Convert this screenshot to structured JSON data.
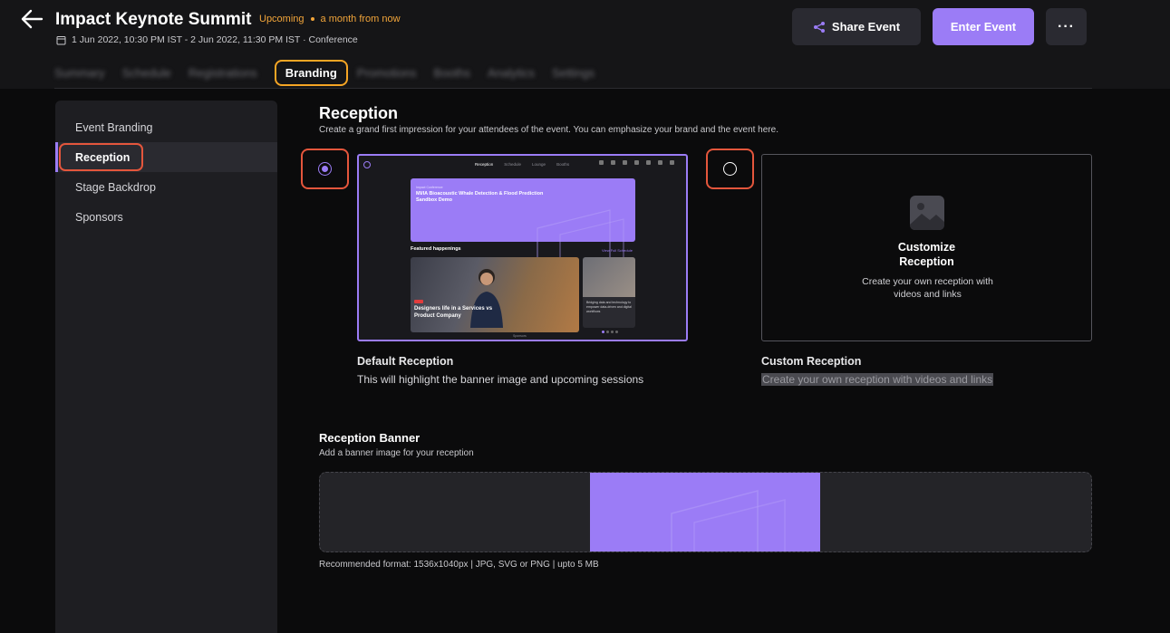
{
  "header": {
    "event_title": "Impact Keynote Summit",
    "status": "Upcoming",
    "relative_time": "a month from now",
    "date_range": "1 Jun 2022, 10:30 PM IST - 2 Jun 2022, 11:30 PM IST · Conference",
    "share_label": "Share Event",
    "enter_label": "Enter Event",
    "more_label": "···"
  },
  "tabs": {
    "items": [
      "Summary",
      "Schedule",
      "Registrations",
      "Branding",
      "Promotions",
      "Booths",
      "Analytics",
      "Settings"
    ],
    "active": "Branding"
  },
  "sidebar": {
    "items": [
      {
        "label": "Event Branding"
      },
      {
        "label": "Reception"
      },
      {
        "label": "Stage Backdrop"
      },
      {
        "label": "Sponsors"
      }
    ],
    "active": "Reception"
  },
  "reception": {
    "title": "Reception",
    "subtitle": "Create a grand first impression for your attendees of the event. You can emphasize your brand and the event here.",
    "default_option": {
      "label": "Default Reception",
      "description": "This will highlight the banner image and upcoming sessions",
      "selected": true,
      "preview": {
        "nav_tabs": [
          "Reception",
          "Schedule",
          "Lounge",
          "Booths"
        ],
        "banner_small": "Impact Conference",
        "banner_title": "MI/IA Bioacoustic Whale Detection & Flood Prediction Sandbox Demo",
        "featured_label": "Featured happenings",
        "view_all": "View Full Schedule",
        "card1_title": "Designers life in a Services vs Product Company",
        "card2_text": "Bridging data and technology to empower data-driven and digital workflows",
        "footer": "Sponsors"
      }
    },
    "custom_option": {
      "card_title": "Customize Reception",
      "card_desc": "Create your own reception with videos and links",
      "label": "Custom Reception",
      "description": "Create your own reception with videos and links",
      "selected": false
    }
  },
  "banner": {
    "title": "Reception Banner",
    "subtitle": "Add a banner image for your reception",
    "note": "Recommended format: 1536x1040px | JPG, SVG or PNG | upto 5 MB"
  },
  "colors": {
    "accent": "#9b7cf6",
    "status": "#f2a53a",
    "highlight": "#e4563c",
    "tab_highlight": "#f5a524"
  }
}
